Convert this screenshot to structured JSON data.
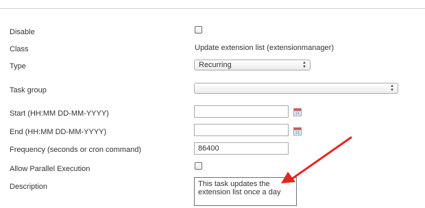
{
  "form": {
    "disable": {
      "label": "Disable",
      "checked": false
    },
    "class": {
      "label": "Class",
      "value": "Update extension list (extensionmanager)"
    },
    "type": {
      "label": "Type",
      "selected": "Recurring"
    },
    "task_group": {
      "label": "Task group",
      "selected": ""
    },
    "start": {
      "label": "Start (HH:MM DD-MM-YYYY)",
      "value": ""
    },
    "end": {
      "label": "End (HH:MM DD-MM-YYYY)",
      "value": ""
    },
    "frequency": {
      "label": "Frequency (seconds or cron command)",
      "value": "86400"
    },
    "parallel": {
      "label": "Allow Parallel Execution",
      "checked": false
    },
    "description": {
      "label": "Description",
      "value": "This task updates the extension list once a day"
    }
  },
  "annotation": {
    "color": "#e8231e"
  },
  "icons": {
    "calendar": "calendar-icon",
    "select_arrows": "updown-arrows-icon"
  }
}
